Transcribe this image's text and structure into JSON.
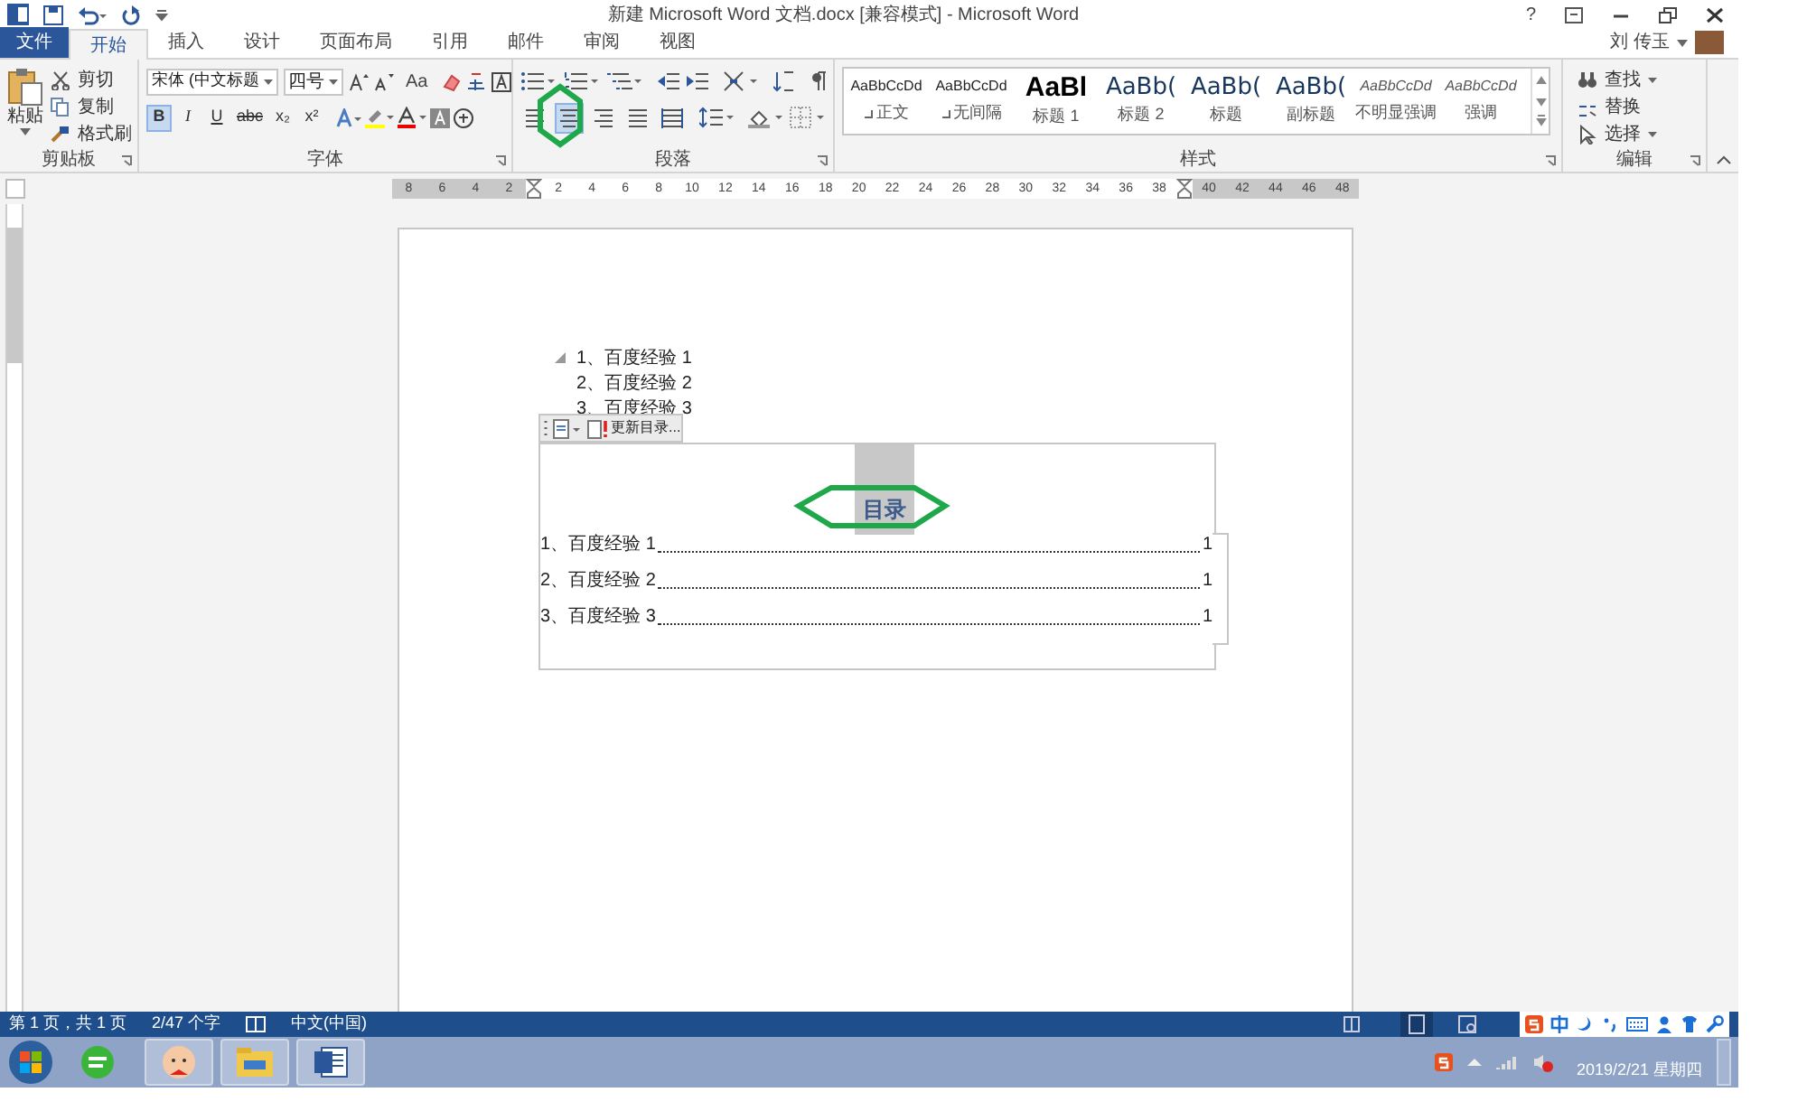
{
  "title_bar": {
    "title": "新建 Microsoft Word 文档.docx [兼容模式] - Microsoft Word",
    "help": "?"
  },
  "tabs": [
    {
      "label": "文件",
      "kind": "file",
      "selected": false
    },
    {
      "label": "开始",
      "kind": "tab",
      "selected": true
    },
    {
      "label": "插入",
      "kind": "tab",
      "selected": false
    },
    {
      "label": "设计",
      "kind": "tab",
      "selected": false
    },
    {
      "label": "页面布局",
      "kind": "tab",
      "selected": false
    },
    {
      "label": "引用",
      "kind": "tab",
      "selected": false
    },
    {
      "label": "邮件",
      "kind": "tab",
      "selected": false
    },
    {
      "label": "审阅",
      "kind": "tab",
      "selected": false
    },
    {
      "label": "视图",
      "kind": "tab",
      "selected": false
    }
  ],
  "user": {
    "name": "刘 传玉"
  },
  "ribbon": {
    "clipboard": {
      "label": "剪贴板",
      "paste": "粘贴",
      "items": [
        "剪切",
        "复制",
        "格式刷"
      ]
    },
    "font": {
      "label": "字体",
      "font_name": "宋体 (中文标题",
      "font_size": "四号",
      "case_button": "Aa",
      "format_buttons": [
        {
          "label": "B",
          "selected": true
        },
        {
          "label": "I",
          "selected": false
        },
        {
          "label": "U",
          "selected": false
        },
        {
          "label": "abc",
          "selected": false
        },
        {
          "label": "x₂",
          "selected": false
        },
        {
          "label": "x²",
          "selected": false
        }
      ]
    },
    "paragraph": {
      "label": "段落",
      "align_buttons": [
        {
          "kind": "left",
          "selected": false
        },
        {
          "kind": "center",
          "selected": true
        },
        {
          "kind": "right",
          "selected": false
        },
        {
          "kind": "justify",
          "selected": false
        },
        {
          "kind": "distributed",
          "selected": false
        }
      ]
    },
    "styles": {
      "label": "样式",
      "items": [
        {
          "preview": "AaBbCcDd",
          "name": "正文",
          "kind": "small",
          "marker": true
        },
        {
          "preview": "AaBbCcDd",
          "name": "无间隔",
          "kind": "small",
          "marker": true
        },
        {
          "preview": "AaBl",
          "name": "标题 1",
          "kind": "heading1",
          "marker": false
        },
        {
          "preview": "AaBb(",
          "name": "标题 2",
          "kind": "heading2",
          "marker": false
        },
        {
          "preview": "AaBb(",
          "name": "标题",
          "kind": "heading2",
          "marker": false
        },
        {
          "preview": "AaBb(",
          "name": "副标题",
          "kind": "heading2",
          "marker": false
        },
        {
          "preview": "AaBbCcDd",
          "name": "不明显强调",
          "kind": "italic",
          "marker": false
        },
        {
          "preview": "AaBbCcDd",
          "name": "强调",
          "kind": "italic",
          "marker": false
        }
      ]
    },
    "editing": {
      "label": "编辑",
      "items": [
        "查找",
        "替换",
        "选择"
      ]
    }
  },
  "ruler": [
    {
      "label": "8",
      "margin": true
    },
    {
      "label": "6",
      "margin": true
    },
    {
      "label": "4",
      "margin": true
    },
    {
      "label": "2",
      "margin": true
    },
    {
      "label": "2",
      "margin": false
    },
    {
      "label": "4",
      "margin": false
    },
    {
      "label": "6",
      "margin": false
    },
    {
      "label": "8",
      "margin": false
    },
    {
      "label": "10",
      "margin": false
    },
    {
      "label": "12",
      "margin": false
    },
    {
      "label": "14",
      "margin": false
    },
    {
      "label": "16",
      "margin": false
    },
    {
      "label": "18",
      "margin": false
    },
    {
      "label": "20",
      "margin": false
    },
    {
      "label": "22",
      "margin": false
    },
    {
      "label": "24",
      "margin": false
    },
    {
      "label": "26",
      "margin": false
    },
    {
      "label": "28",
      "margin": false
    },
    {
      "label": "30",
      "margin": false
    },
    {
      "label": "32",
      "margin": false
    },
    {
      "label": "34",
      "margin": false
    },
    {
      "label": "36",
      "margin": false
    },
    {
      "label": "38",
      "margin": false
    },
    {
      "label": "40",
      "margin": true
    },
    {
      "label": "42",
      "margin": true
    },
    {
      "label": "44",
      "margin": true
    },
    {
      "label": "46",
      "margin": true
    },
    {
      "label": "48",
      "margin": true
    }
  ],
  "document": {
    "outline": [
      "1、百度经验 1",
      "2、百度经验 2",
      "3、百度经验 3"
    ],
    "toc": {
      "update_button": "更新目录...",
      "title": "目录",
      "entries": [
        {
          "text": "1、百度经验 1",
          "page": "1"
        },
        {
          "text": "2、百度经验 2",
          "page": "1"
        },
        {
          "text": "3、百度经验 3",
          "page": "1"
        }
      ]
    }
  },
  "status_bar": {
    "page": "第 1 页，共 1 页",
    "words": "2/47 个字",
    "language": "中文(中国)"
  },
  "taskbar": {
    "date": "2019/2/21 星期四"
  }
}
